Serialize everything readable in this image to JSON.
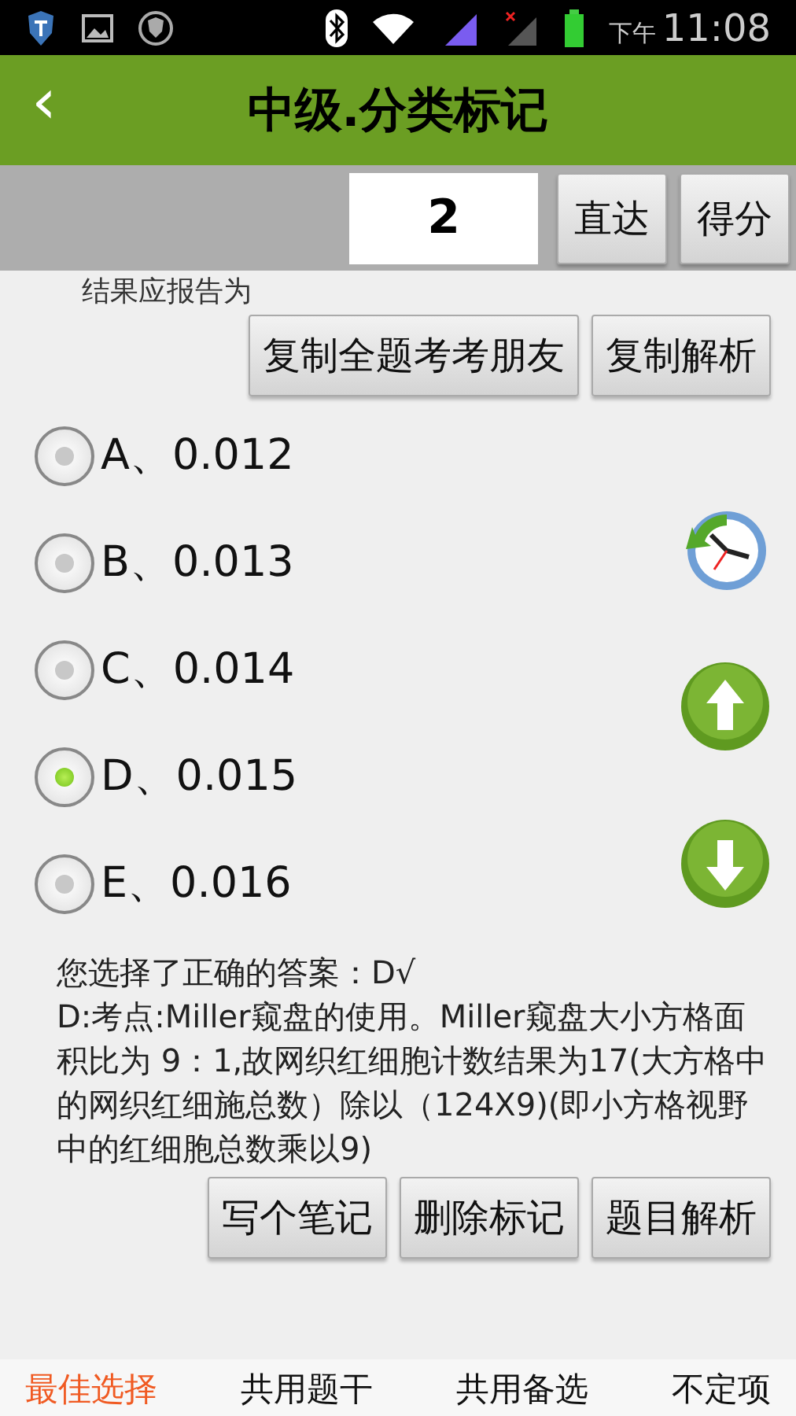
{
  "status_bar": {
    "time": "11:08",
    "period": "下午"
  },
  "header": {
    "back": "‹",
    "title": "中级.分类标记"
  },
  "toolbar": {
    "page_value": "2",
    "buttons": [
      "直达",
      "得分"
    ]
  },
  "question_tail": "结果应报告为",
  "copy_buttons": [
    "复制全题考考朋友",
    "复制解析"
  ],
  "options": [
    {
      "label": "A、0.012",
      "selected": false
    },
    {
      "label": "B、0.013",
      "selected": false
    },
    {
      "label": "C、0.014",
      "selected": false
    },
    {
      "label": "D、0.015",
      "selected": true
    },
    {
      "label": "E、0.016",
      "selected": false
    }
  ],
  "result": "您选择了正确的答案：D√",
  "explanation": "D:考点:Miller窥盘的使用。Miller窥盘大小方格面积比为 9：1,故网织红细胞计数结果为17(大方格中的网织红细施总数）除以（124X9)(即小方格视野中的红细胞总数乘以9)",
  "action_buttons": [
    "写个笔记",
    "删除标记",
    "题目解析"
  ],
  "bottom_tabs": [
    {
      "label": "最佳选择",
      "selected": true
    },
    {
      "label": "共用题干",
      "selected": false
    },
    {
      "label": "共用备选",
      "selected": false
    },
    {
      "label": "不定项",
      "selected": false
    }
  ]
}
